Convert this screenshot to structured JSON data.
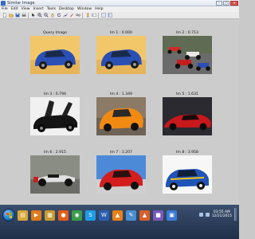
{
  "window": {
    "title": "Similar Image",
    "controls": {
      "minimize": "–",
      "maximize": "□",
      "close": "✕"
    }
  },
  "menu": [
    "File",
    "Edit",
    "View",
    "Insert",
    "Tools",
    "Desktop",
    "Window",
    "Help"
  ],
  "toolbar": {
    "icons": [
      "new-icon",
      "open-icon",
      "save-icon",
      "print-icon",
      "pointer-icon",
      "zoom-in-icon",
      "zoom-out-icon",
      "pan-icon",
      "rotate-icon",
      "data-cursor-icon",
      "brush-icon",
      "link-icon",
      "colorbar-icon",
      "legend-icon",
      "hide-plot-tools-icon",
      "show-plot-tools-icon"
    ]
  },
  "results": [
    {
      "label": "Query Image",
      "subject": "blue hatchback",
      "colors": [
        "#f2c76a",
        "#2a4fb5"
      ]
    },
    {
      "label": "Im 1 : 0.000",
      "subject": "blue hatchback",
      "colors": [
        "#f2c76a",
        "#2a4fb5"
      ]
    },
    {
      "label": "Im 2 : 0.713",
      "subject": "formula race cars",
      "colors": [
        "#5f6b52",
        "#d02a2a"
      ]
    },
    {
      "label": "Im 3 : 0.794",
      "subject": "black supercar with open doors",
      "colors": [
        "#f1f1f1",
        "#141414"
      ]
    },
    {
      "label": "Im 4 : 1.349",
      "subject": "orange supercar",
      "colors": [
        "#8a7a66",
        "#f08a12"
      ]
    },
    {
      "label": "Im 5 : 1.631",
      "subject": "red sports car",
      "colors": [
        "#2a2a30",
        "#c8181c"
      ]
    },
    {
      "label": "Im 6 : 2.915",
      "subject": "formula race car",
      "colors": [
        "#8a8d83",
        "#e0e0e0"
      ]
    },
    {
      "label": "Im 7 : 3.207",
      "subject": "red sports car",
      "colors": [
        "#4c8ad8",
        "#d41d1d"
      ]
    },
    {
      "label": "Im 8 : 3.958",
      "subject": "blue rally car",
      "colors": [
        "#f7f7f7",
        "#2154b8"
      ]
    }
  ],
  "taskbar": {
    "apps": [
      {
        "name": "explorer-icon",
        "glyph": "▤",
        "color": "#d7a83a"
      },
      {
        "name": "media-player-icon",
        "glyph": "▶",
        "color": "#e07a1a"
      },
      {
        "name": "folder-icon",
        "glyph": "▦",
        "color": "#c99a2e"
      },
      {
        "name": "firefox-icon",
        "glyph": "●",
        "color": "#e35d1a"
      },
      {
        "name": "chrome-icon",
        "glyph": "◉",
        "color": "#3a9d4a"
      },
      {
        "name": "skype-icon",
        "glyph": "S",
        "color": "#1e9be6"
      },
      {
        "name": "word-icon",
        "glyph": "W",
        "color": "#2a5fb0"
      },
      {
        "name": "vlc-icon",
        "glyph": "▲",
        "color": "#e8801a"
      },
      {
        "name": "paint-icon",
        "glyph": "✎",
        "color": "#4a8fd0"
      },
      {
        "name": "matlab-icon",
        "glyph": "▲",
        "color": "#d8602a"
      },
      {
        "name": "app-icon",
        "glyph": "■",
        "color": "#7a5ab8"
      },
      {
        "name": "figure-window-icon",
        "glyph": "▣",
        "color": "#3a7bd5"
      }
    ],
    "clock": {
      "time": "03:55 AM",
      "date": "12/21/2015"
    }
  }
}
